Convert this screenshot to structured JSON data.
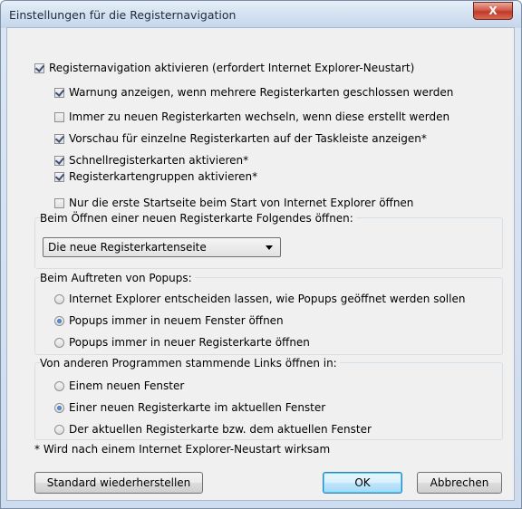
{
  "window": {
    "title": "Einstellungen für die Registernavigation",
    "close_glyph": "X"
  },
  "main_checkbox": {
    "label": "Registernavigation aktivieren (erfordert Internet Explorer-Neustart)",
    "checked": true
  },
  "options": [
    {
      "label": "Warnung anzeigen, wenn mehrere Registerkarten geschlossen werden",
      "checked": true
    },
    {
      "label": "Immer zu neuen Registerkarten wechseln, wenn diese erstellt werden",
      "checked": false
    },
    {
      "label": "Vorschau für einzelne Registerkarten auf der Taskleiste anzeigen*",
      "checked": true
    },
    {
      "label": "Schnellregisterkarten aktivieren*",
      "checked": true
    },
    {
      "label": "Registerkartengruppen aktivieren*",
      "checked": true
    },
    {
      "label": "Nur die erste Startseite beim Start von Internet Explorer öffnen",
      "checked": false
    }
  ],
  "new_tab_group": {
    "label": "Beim Öffnen einer neuen Registerkarte Folgendes öffnen:",
    "selected": "Die neue Registerkartenseite"
  },
  "popup_group": {
    "label": "Beim Auftreten von Popups:",
    "options": [
      {
        "label": "Internet Explorer entscheiden lassen, wie Popups geöffnet werden sollen",
        "checked": false
      },
      {
        "label": "Popups immer in neuem Fenster öffnen",
        "checked": true
      },
      {
        "label": "Popups immer in neuer Registerkarte öffnen",
        "checked": false
      }
    ]
  },
  "links_group": {
    "label": "Von anderen Programmen stammende Links öffnen in:",
    "options": [
      {
        "label": "Einem neuen Fenster",
        "checked": false
      },
      {
        "label": "Einer neuen Registerkarte im aktuellen Fenster",
        "checked": true
      },
      {
        "label": "Der aktuellen Registerkarte bzw. dem aktuellen Fenster",
        "checked": false
      }
    ]
  },
  "footnote": "* Wird nach einem Internet Explorer-Neustart wirksam",
  "buttons": {
    "restore": "Standard wiederherstellen",
    "ok": "OK",
    "cancel": "Abbrechen"
  }
}
